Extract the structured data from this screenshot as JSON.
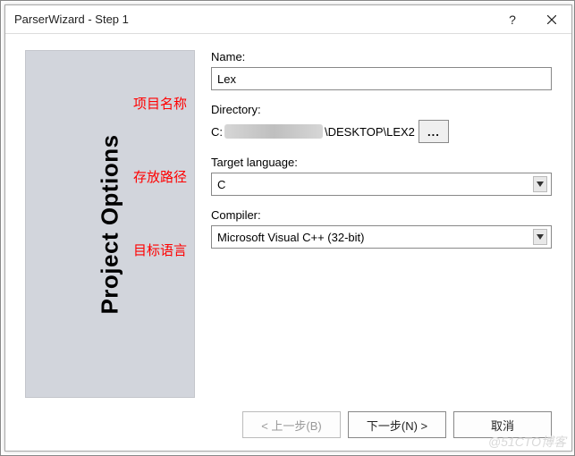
{
  "window": {
    "title": "ParserWizard - Step 1",
    "help_icon": "?",
    "close_icon": "×"
  },
  "sidebar": {
    "title": "Project Options"
  },
  "annotations": {
    "name": "项目名称",
    "directory": "存放路径",
    "language": "目标语言"
  },
  "fields": {
    "name_label": "Name:",
    "name_value": "Lex",
    "directory_label": "Directory:",
    "directory_prefix": "C:",
    "directory_suffix": "\\DESKTOP\\LEX2",
    "browse_label": "...",
    "language_label": "Target language:",
    "language_value": "C",
    "compiler_label": "Compiler:",
    "compiler_value": "Microsoft Visual C++ (32-bit)"
  },
  "buttons": {
    "back": "< 上一步(B)",
    "next": "下一步(N) >",
    "cancel": "取消"
  },
  "watermark": "@51CTO博客"
}
